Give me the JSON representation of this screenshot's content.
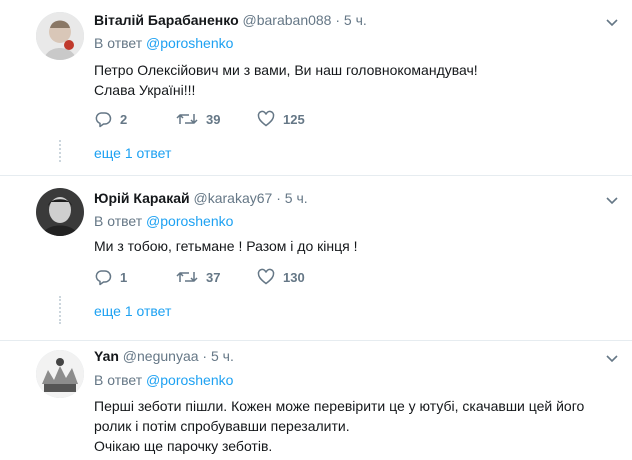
{
  "tweets": [
    {
      "name": "Віталій Барабаненко",
      "handle": "@baraban088",
      "dot": "·",
      "time": "5 ч.",
      "reply_prefix": "В ответ",
      "reply_mention": "@poroshenko",
      "text": "Петро Олексійович ми з вами, Ви наш головнокомандувач!\nСлава Україні!!!",
      "replies": "2",
      "retweets": "39",
      "likes": "125",
      "more": "еще 1 ответ"
    },
    {
      "name": "Юрій Каракай",
      "handle": "@karakay67",
      "dot": "·",
      "time": "5 ч.",
      "reply_prefix": "В ответ",
      "reply_mention": "@poroshenko",
      "text": "Ми з тобою, гетьмане ! Разом і до кінця !",
      "replies": "1",
      "retweets": "37",
      "likes": "130",
      "more": "еще 1 ответ"
    },
    {
      "name": "Yan",
      "handle": "@negunyaa",
      "dot": "·",
      "time": "5 ч.",
      "reply_prefix": "В ответ",
      "reply_mention": "@poroshenko",
      "text": "Перші зеботи пішли. Кожен може перевірити це у ютубі, скачавши цей його\nролик і потім спробувавши перезалити.\nОчікаю ще парочку зеботів."
    }
  ],
  "colors": {
    "accent": "#1da1f2",
    "secondary": "#657786",
    "text": "#14171a",
    "divider": "#e6ecf0"
  },
  "icons": {
    "reply": "reply-icon",
    "retweet": "retweet-icon",
    "like": "heart-icon",
    "menu": "chevron-down-icon"
  }
}
